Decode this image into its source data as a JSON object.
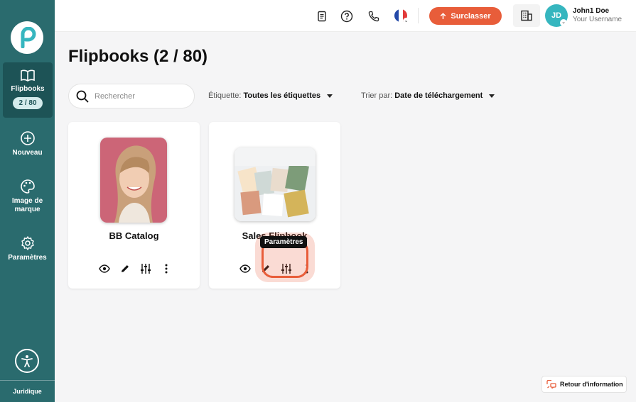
{
  "sidebar": {
    "nav": [
      {
        "label": "Flipbooks",
        "badge": "2 / 80",
        "icon": "book-open-icon"
      },
      {
        "label": "Nouveau",
        "icon": "plus-circle-icon"
      },
      {
        "label": "Image de marque",
        "icon": "palette-icon"
      },
      {
        "label": "Paramètres",
        "icon": "gear-icon"
      }
    ],
    "footer_label": "Juridique"
  },
  "header": {
    "upgrade_label": "Surclasser",
    "user_name": "John1 Doe",
    "user_sub": "Your Username",
    "avatar_initials": "JD"
  },
  "main": {
    "title": "Flipbooks (2 / 80)",
    "search_placeholder": "Rechercher",
    "tag_filter": {
      "label": "Étiquette:",
      "value": "Toutes les étiquettes"
    },
    "sort_filter": {
      "label": "Trier par:",
      "value": "Date de téléchargement"
    },
    "cards": [
      {
        "title": "BB Catalog"
      },
      {
        "title": "Sales Flipbook"
      }
    ],
    "tooltip": "Paramètres"
  },
  "feedback_label": "Retour d'information",
  "colors": {
    "sidebar": "#2a6b6e",
    "accent": "#e85d3a",
    "avatar": "#36b6bf"
  }
}
